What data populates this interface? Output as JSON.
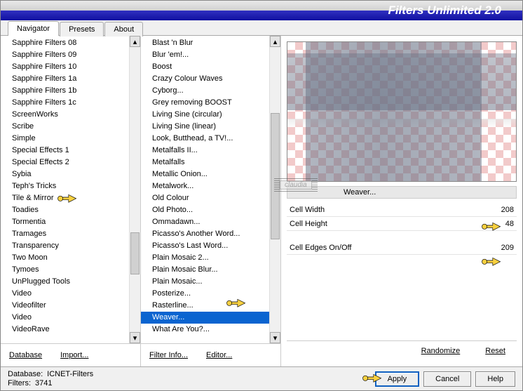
{
  "title": "Filters Unlimited 2.0",
  "tabs": [
    "Navigator",
    "Presets",
    "About"
  ],
  "active_tab": 0,
  "categories": [
    "Sapphire Filters 08",
    "Sapphire Filters 09",
    "Sapphire Filters 10",
    "Sapphire Filters 1a",
    "Sapphire Filters 1b",
    "Sapphire Filters 1c",
    "ScreenWorks",
    "Scribe",
    "Simple",
    "Special Effects 1",
    "Special Effects 2",
    "Sybia",
    "Teph's Tricks",
    "Tile & Mirror",
    "Toadies",
    "Tormentia",
    "Tramages",
    "Transparency",
    "Two Moon",
    "Tymoes",
    "UnPlugged Tools",
    "Video",
    "Videofilter",
    "Video",
    "VideoRave"
  ],
  "selected_category_index": 14,
  "filters": [
    "Blast 'n Blur",
    "Blur 'em!...",
    "Boost",
    "Crazy Colour Waves",
    "Cyborg...",
    "Grey removing BOOST",
    "Living Sine (circular)",
    "Living Sine (linear)",
    "Look, Butthead, a TV!...",
    "Metalfalls II...",
    "Metalfalls",
    "Metallic Onion...",
    "Metalwork...",
    "Old Colour",
    "Old Photo...",
    "Ommadawn...",
    "Picasso's Another Word...",
    "Picasso's Last Word...",
    "Plain Mosaic 2...",
    "Plain Mosaic Blur...",
    "Plain Mosaic...",
    "Posterize...",
    "Rasterline...",
    "Weaver...",
    "What Are You?..."
  ],
  "selected_filter_index": 23,
  "cat_buttons": {
    "database": "Database",
    "import": "Import..."
  },
  "filter_buttons": {
    "info": "Filter Info...",
    "editor": "Editor..."
  },
  "filter_name": "Weaver...",
  "parameters": [
    {
      "label": "Cell Width",
      "value": "208",
      "pointer": true
    },
    {
      "label": "Cell Height",
      "value": "48",
      "pointer": false
    }
  ],
  "param_group2": [
    {
      "label": "Cell Edges On/Off",
      "value": "209",
      "pointer": true
    }
  ],
  "right_buttons": {
    "randomize": "Randomize",
    "reset": "Reset"
  },
  "footer": {
    "db_label": "Database:",
    "db_value": "ICNET-Filters",
    "filters_label": "Filters:",
    "filters_value": "3741",
    "apply": "Apply",
    "cancel": "Cancel",
    "help": "Help"
  },
  "watermark": "claudia"
}
